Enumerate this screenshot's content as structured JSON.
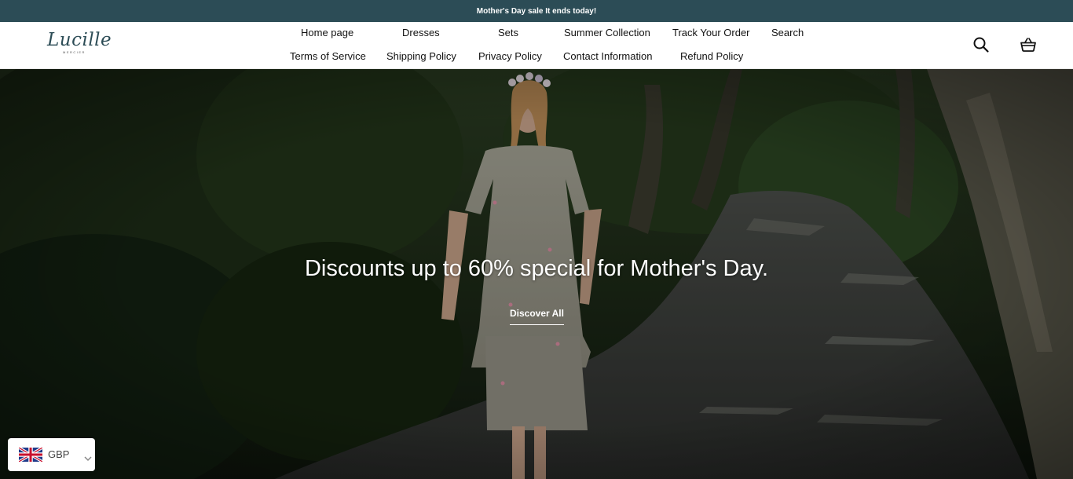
{
  "announcement": {
    "text": "Mother's Day sale It ends today!"
  },
  "header": {
    "logo_text": "Lucille",
    "logo_subtext": "MERCIER",
    "nav_row1": [
      "Home page",
      "Dresses",
      "Sets",
      "Summer Collection",
      "Track Your Order",
      "Search"
    ],
    "nav_row2": [
      "Terms of Service",
      "Shipping Policy",
      "Privacy Policy",
      "Contact Information",
      "Refund Policy"
    ],
    "icons": [
      "search-icon",
      "shopping-basket-icon"
    ]
  },
  "hero": {
    "title": "Discounts up to 60% special for Mother's Day.",
    "cta_label": "Discover All"
  },
  "currency_selector": {
    "selected": "GBP",
    "flag_icon": "uk-flag-icon"
  },
  "colors": {
    "announcement_bg": "#2c4c56",
    "logo": "#2c4c56",
    "header_bg": "#ffffff",
    "hero_text": "#ffffff"
  }
}
